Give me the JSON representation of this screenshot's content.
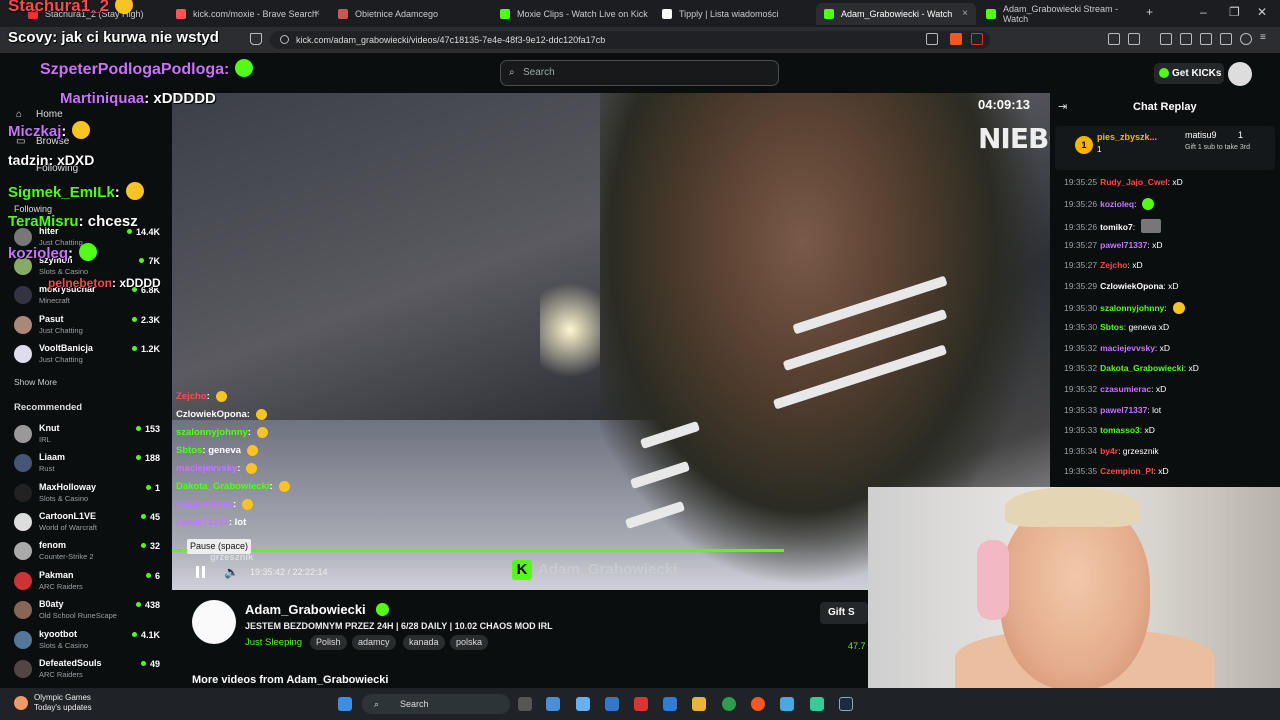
{
  "browser": {
    "tabs": [
      {
        "label": "Stachura1_2 (Stay High)",
        "active": false
      },
      {
        "label": "kick.com/moxie - Brave Search",
        "active": false
      },
      {
        "label": "Obietnice Adamcego",
        "active": false
      },
      {
        "label": "Moxie Clips - Watch Live on Kick",
        "active": false
      },
      {
        "label": "Tipply | Lista wiadomości",
        "active": false
      },
      {
        "label": "Adam_Grabowiecki - Watch",
        "active": true
      },
      {
        "label": "Adam_Grabowiecki Stream - Watch",
        "active": false
      }
    ],
    "new_tab": "+",
    "url": "kick.com/adam_grabowiecki/videos/47c18135-7e4e-48f3-9e12-ddc120fa17cb"
  },
  "kick": {
    "search_placeholder": "Search",
    "get_kicks": "Get KICKs"
  },
  "sidebar": {
    "nav": {
      "home": "Home",
      "browse": "Browse",
      "following": "Following"
    },
    "following_header": "Following",
    "following": [
      {
        "name": "hiter",
        "game": "Just Chatting",
        "viewers": "14.4K"
      },
      {
        "name": "szymon",
        "game": "Slots & Casino",
        "viewers": "7K"
      },
      {
        "name": "mokrysuchar",
        "game": "Minecraft",
        "viewers": "6.8K"
      },
      {
        "name": "Pasut",
        "game": "Just Chatting",
        "viewers": "2.3K"
      },
      {
        "name": "VooltBanicja",
        "game": "Just Chatting",
        "viewers": "1.2K"
      }
    ],
    "show_more": "Show More",
    "recommended_header": "Recommended",
    "recommended": [
      {
        "name": "Knut",
        "game": "IRL",
        "viewers": "153"
      },
      {
        "name": "Liaam",
        "game": "Rust",
        "viewers": "188"
      },
      {
        "name": "MaxHolloway",
        "game": "Slots & Casino",
        "viewers": "1"
      },
      {
        "name": "CartoonL1VE",
        "game": "World of Warcraft",
        "viewers": "45"
      },
      {
        "name": "fenom",
        "game": "Counter-Strike 2",
        "viewers": "32"
      },
      {
        "name": "Pakman",
        "game": "ARC Raiders",
        "viewers": "6"
      },
      {
        "name": "B0aty",
        "game": "Old School RuneScape",
        "viewers": "438"
      },
      {
        "name": "kyootbot",
        "game": "Slots & Casino",
        "viewers": "4.1K"
      },
      {
        "name": "DefeatedSouls",
        "game": "ARC Raiders",
        "viewers": "49"
      }
    ]
  },
  "overlay_chat": [
    {
      "user": "Stachura1_2",
      "msg": "",
      "color": "#ff4a4a"
    },
    {
      "user": "Scovy",
      "msg": ": jak ci kurwa nie wstyd",
      "color": "#ffffff"
    },
    {
      "user": "SzpeterPodlogaPodloga",
      "msg": ":",
      "color": "#c874ff"
    },
    {
      "user": "Martiniquaa",
      "msg": ": xDDDDD",
      "color": "#c874ff"
    },
    {
      "user": "Miczkaj",
      "msg": ":",
      "color": "#c874ff"
    },
    {
      "user": "tadzin",
      "msg": ": xDXD",
      "color": "#ffffff"
    },
    {
      "user": "Sigmek_EmILk",
      "msg": ":",
      "color": "#53fc18"
    },
    {
      "user": "TeraMisru",
      "msg": ": chcesz",
      "color": "#53fc18"
    },
    {
      "user": "kozioleq",
      "msg": ":",
      "color": "#c874ff"
    },
    {
      "user": "pelnebeton",
      "msg": ": xDDDD",
      "color": "#ff4a4a"
    }
  ],
  "video": {
    "timer": "04:09:13",
    "sign": "NIEBO",
    "tooltip": "Pause (space)",
    "time": "19:35:42 / 22:22:14",
    "watermark": "Adam_Grabowiecki",
    "watermark_logo": "K",
    "progress": 0.88,
    "chat": [
      {
        "user": "Zejcho",
        "msg": ":",
        "color": "#ff4a4a"
      },
      {
        "user": "CzlowiekOpona",
        "msg": ":",
        "color": "#ffffff"
      },
      {
        "user": "szalonnyjohnny",
        "msg": ":",
        "color": "#53fc18"
      },
      {
        "user": "Sbtos",
        "msg": ": geneva",
        "color": "#53fc18"
      },
      {
        "user": "maciejevvsky",
        "msg": ":",
        "color": "#c874ff"
      },
      {
        "user": "Dakota_Grabowiecki",
        "msg": ":",
        "color": "#53fc18"
      },
      {
        "user": "czasumierac",
        "msg": ":",
        "color": "#c874ff"
      },
      {
        "user": "pawel71337",
        "msg": ": lot",
        "color": "#c874ff"
      },
      {
        "user": "grzesznik",
        "msg": "",
        "color": "#ffffff"
      }
    ]
  },
  "stream": {
    "channel": "Adam_Grabowiecki",
    "title": "JESTEM BEZDOMNYM PRZEZ 24H | 6/28 DAILY | 10.02 CHAOS MOD IRL",
    "category": "Just Sleeping",
    "tags": [
      "Polish",
      "adamcy",
      "kanada",
      "polska"
    ],
    "gift": "Gift S",
    "viewers": "47.7",
    "more_videos": "More videos from Adam_Grabowiecki"
  },
  "chat_replay": {
    "header": "Chat Replay",
    "pinned": {
      "rank": "1",
      "user": "pies_zbyszk...",
      "count": "1",
      "gifter": "matisu9",
      "gifter_count": "1",
      "gift_text": "Gift 1 sub to take 3rd"
    },
    "messages": [
      {
        "ts": "19:35:25",
        "user": "Rudy_Jajo_Cwel",
        "msg": ": xD",
        "color": "#ff4a4a"
      },
      {
        "ts": "19:35:26",
        "user": "kozioleq",
        "msg": ":",
        "color": "#c874ff"
      },
      {
        "ts": "19:35:26",
        "user": "tomiko7",
        "msg": ":",
        "color": "#ffffff"
      },
      {
        "ts": "19:35:27",
        "user": "pawel71337",
        "msg": ": xD",
        "color": "#c874ff"
      },
      {
        "ts": "19:35:27",
        "user": "Zejcho",
        "msg": ": xD",
        "color": "#ff4a4a"
      },
      {
        "ts": "19:35:29",
        "user": "CzlowiekOpona",
        "msg": ": xD",
        "color": "#ffffff"
      },
      {
        "ts": "19:35:30",
        "user": "szalonnyjohnny",
        "msg": ":",
        "color": "#53fc18"
      },
      {
        "ts": "19:35:30",
        "user": "Sbtos",
        "msg": ": geneva xD",
        "color": "#53fc18"
      },
      {
        "ts": "19:35:32",
        "user": "maciejevvsky",
        "msg": ": xD",
        "color": "#c874ff"
      },
      {
        "ts": "19:35:32",
        "user": "Dakota_Grabowiecki",
        "msg": ": xD",
        "color": "#53fc18"
      },
      {
        "ts": "19:35:32",
        "user": "czasumierac",
        "msg": ": xD",
        "color": "#c874ff"
      },
      {
        "ts": "19:35:33",
        "user": "pawel71337",
        "msg": ": lot",
        "color": "#c874ff"
      },
      {
        "ts": "19:35:33",
        "user": "tomasso3",
        "msg": ": xD",
        "color": "#53fc18"
      },
      {
        "ts": "19:35:34",
        "user": "by4r",
        "msg": ": grzesznik",
        "color": "#ff4a4a"
      },
      {
        "ts": "19:35:35",
        "user": "Czempion_Pl",
        "msg": ": xD",
        "color": "#ff4a4a"
      }
    ]
  },
  "taskbar": {
    "weather_title": "Olympic Games",
    "weather_sub": "Today's updates",
    "search": "Search"
  },
  "colors": {
    "kick_green": "#53fc18",
    "bg": "#0b0e0f"
  }
}
